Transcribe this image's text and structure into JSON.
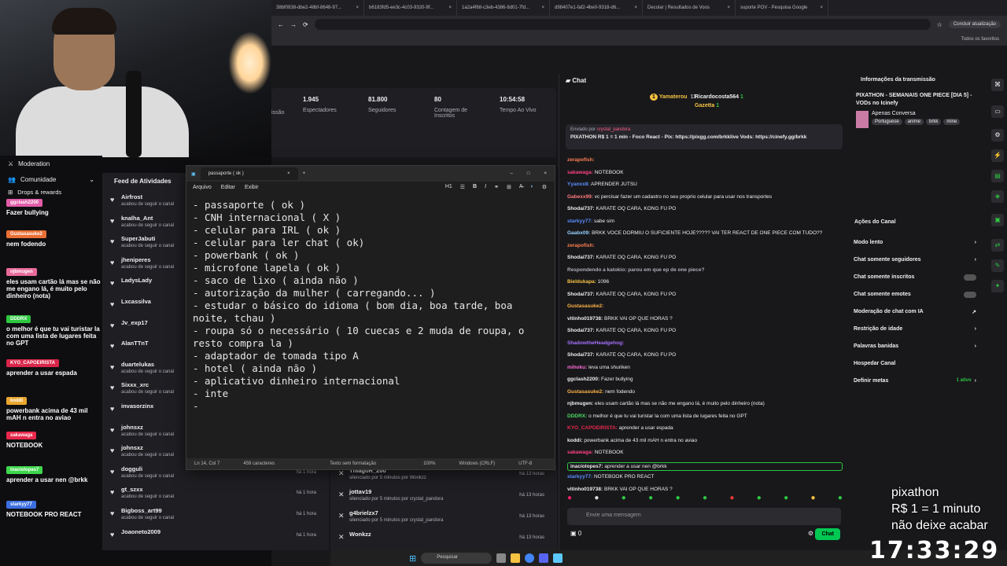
{
  "browser": {
    "tabs": [
      "38bf0938-dbe2-48bf-8648-97...",
      "b6183fd5-ee3c-4c03-9320-9f...",
      "1a2a4f68-c3eb-4386-8d01-7fd...",
      "d98407e1-faf2-4be0-9318-d6...",
      "Decolar | Resultados de Voos",
      "suporte POV - Pesquisa Google"
    ],
    "update_button": "Concluir atualização",
    "favorites": "Todos os favoritos"
  },
  "stats": [
    {
      "value": "1.945",
      "label": "Espectadores"
    },
    {
      "value": "81.800",
      "label": "Seguidores"
    },
    {
      "value": "80",
      "label": "Contagem de Inscritos"
    },
    {
      "value": "10:54:58",
      "label": "Tempo Ao Vivo"
    }
  ],
  "stats_partial": "issão",
  "left_nav": {
    "moderation": "Moderation",
    "community": "Comunidade",
    "drops": "Drops & rewards"
  },
  "alerts": [
    {
      "tag": "ggclash2200",
      "msg": "Fazer bullying",
      "color": "#e25ca8"
    },
    {
      "tag": "Gustasasuke2",
      "msg": "nem fodendo",
      "color": "#e96f35"
    },
    {
      "tag": "njbmugen",
      "msg": "eles usam cartão lá mas se não me engano lá, é muito pelo dinheiro (nota)",
      "color": "#e86a9a"
    },
    {
      "tag": "DDDRX",
      "msg": "o melhor é que tu vai turistar la com uma lista de lugares feita no GPT",
      "color": "#2ec741"
    },
    {
      "tag": "KYO_CAPOEIRISTA",
      "msg": "aprender a usar espada",
      "color": "#d9264a"
    },
    {
      "tag": "koddi",
      "msg": "powerbank acima de 43 mil mAH n entra no aviao",
      "color": "#e9a72f"
    },
    {
      "tag": "sakawaga",
      "msg": "NOTEBOOK",
      "color": "#e8284b"
    },
    {
      "tag": "inaciolopes7",
      "msg": "aprender a usar nen @brkk",
      "color": "#3fd64d"
    },
    {
      "tag": "starkyy77",
      "msg": "NOTEBOOK PRO REACT",
      "color": "#3c6fe0"
    }
  ],
  "feed": {
    "title": "Feed de Atividades",
    "items": [
      {
        "name": "Airfrost",
        "sub": "acabou de seguir o canal",
        "time": "há 1 hora"
      },
      {
        "name": "knalha_Ant",
        "sub": "acabou de seguir o canal",
        "time": "há 1 hora"
      },
      {
        "name": "SuperJabuti",
        "sub": "acabou de seguir o canal",
        "time": "há 1 hora"
      },
      {
        "name": "jheniperes",
        "sub": "acabou de seguir o canal",
        "time": "há 1 hora"
      },
      {
        "name": "LadysLady",
        "sub": "",
        "time": ""
      },
      {
        "name": "Lxcassilva",
        "sub": "",
        "time": ""
      },
      {
        "name": "Jv_exp17",
        "sub": "",
        "time": ""
      },
      {
        "name": "AlanTTnT",
        "sub": "",
        "time": ""
      },
      {
        "name": "duartelukas",
        "sub": "acabou de seguir o canal",
        "time": "há 1 hora"
      },
      {
        "name": "Sixxx_xrc",
        "sub": "acabou de seguir o canal",
        "time": "há 1 hora"
      },
      {
        "name": "invasorzinx",
        "sub": "",
        "time": ""
      },
      {
        "name": "johnsxz",
        "sub": "acabou de seguir o canal",
        "time": "há 1 hora"
      },
      {
        "name": "johnsxz",
        "sub": "acabou de seguir o canal",
        "time": "há 1 hora"
      },
      {
        "name": "dogguli",
        "sub": "acabou de seguir o canal",
        "time": "há 1 hora"
      },
      {
        "name": "gt_szxx",
        "sub": "acabou de seguir o canal",
        "time": "há 1 hora"
      },
      {
        "name": "Bigboss_art99",
        "sub": "acabou de seguir o canal",
        "time": "há 1 hora"
      },
      {
        "name": "Joaoneto2009",
        "sub": "",
        "time": "há 1 hora"
      }
    ]
  },
  "modfeed": [
    {
      "name": "ThiagoR_200",
      "sub": "silenciado por 5 minutos por Wonkzz",
      "time": "há 13 horas"
    },
    {
      "name": "jottav19",
      "sub": "silenciado por 5 minutos por crystal_pandora",
      "time": "há 13 horas"
    },
    {
      "name": "g4brielzx7",
      "sub": "silenciado por 5 minutos por crystal_pandora",
      "time": "há 13 horas"
    },
    {
      "name": "Wonkzz",
      "sub": "",
      "time": "há 13 horas"
    }
  ],
  "notepad": {
    "tab": "passaporte ( ok )",
    "menu": [
      "Arquivo",
      "Editar",
      "Exibir"
    ],
    "heading": "H1",
    "text": "- passaporte ( ok )\n- CNH internacional ( X )\n- celular para IRL ( ok )\n- celular para ler chat ( ok)\n- powerbank ( ok )\n- microfone lapela ( ok )\n- saco de lixo ( ainda não )\n- autorização da mulher ( carregando... )\n- estudar o básico do idioma ( bom dia, boa tarde, boa noite, tchau )\n- roupa só o necessário ( 10 cuecas e 2 muda de roupa, o resto compra la )\n- adaptador de tomada tipo A\n- hotel ( ainda não )\n- aplicativo dinheiro internacional\n- inte\n-",
    "status": [
      "Ln 14, Col 7",
      "459 caracteres",
      "Texto sem formatação",
      "100%",
      "Windows (CRLF)",
      "UTF-8"
    ]
  },
  "chat": {
    "title": "Chat",
    "top_users": [
      {
        "name": "Yamaterou",
        "count": "11"
      },
      {
        "name": "Ricardocosta564",
        "count": "1"
      },
      {
        "name": "Gazetta",
        "count": "1"
      }
    ],
    "pinned_by": "Enviado por",
    "pinned_user": "crystal_pandora",
    "pinned_text": "PIXATHON R$ 1 = 1 min - Foco React - Pix: https://pixgg.com/brkklive Vods: https://cinefy.gg/brkk",
    "messages": [
      {
        "user": "zerapofish:",
        "text": "",
        "color": "#ff7f50"
      },
      {
        "user": "sakawaga:",
        "text": "NOTEBOOK",
        "color": "#ff4081"
      },
      {
        "user": "Yyanxx8:",
        "text": "APRENDER JUTSU",
        "color": "#5b8dff"
      },
      {
        "user": "Gabexx99:",
        "text": "vc percisar fazer um cadastro no seu proprio celular para usar nos transportes",
        "color": "#ff7b7b"
      },
      {
        "user": "Shodai737:",
        "text": "KARATÊ OQ CARA, KONG FU PÔ",
        "color": "#efeff1"
      },
      {
        "user": "starkyy77:",
        "text": "sabe sim",
        "color": "#5b8dff"
      },
      {
        "user": "Gaabx09:",
        "text": "BRKK VOCE DORMIU O SUFICIENTE HOJE????? VAI TER REACT DE ONE PIECE COM TUDO??",
        "color": "#9ad3ff"
      },
      {
        "user": "zerapofish:",
        "text": "",
        "color": "#ff7f50"
      },
      {
        "user": "Shodai737:",
        "text": "KARATÊ OQ CARA, KONG FU PÔ",
        "color": "#efeff1"
      },
      {
        "user": "Respondendo a katokio: parou em que ep de one piece?",
        "text": "",
        "color": "#adadb8"
      },
      {
        "user": "Bieldukapa:",
        "text": "1096",
        "color": "#f5c242"
      },
      {
        "user": "Shodai737:",
        "text": "KARATÊ OQ CARA, KONG FU PÔ",
        "color": "#efeff1"
      },
      {
        "user": "Gustasasuke2:",
        "text": "",
        "color": "#ffb347"
      },
      {
        "user": "vitinho019738:",
        "text": "BRKK VAI OP QUE HORAS ?",
        "color": "#efeff1"
      },
      {
        "user": "Shodai737:",
        "text": "KARATÊ OQ CARA, KONG FU PÔ",
        "color": "#efeff1"
      },
      {
        "user": "ShadowtheHeadgehog:",
        "text": "",
        "color": "#a970ff"
      },
      {
        "user": "Shodai737:",
        "text": "KARATÊ OQ CARA, KONG FU PÔ",
        "color": "#efeff1"
      },
      {
        "user": "mihoku:",
        "text": "leva uma shuriken",
        "color": "#ff6bd5"
      },
      {
        "user": "ggclash2200:",
        "text": "Fazer bullying",
        "color": "#efeff1"
      },
      {
        "user": "Gustasasuke2:",
        "text": "nem fodendo",
        "color": "#ffb347"
      },
      {
        "user": "njbmugen:",
        "text": "eles usam cartão lá mas se não me engano lá, é muito pelo dinheiro (nota)",
        "color": "#efeff1"
      },
      {
        "user": "DDDRX:",
        "text": "o melhor é que tu vai turistar la com uma lista de lugares feita no GPT",
        "color": "#4cd964"
      },
      {
        "user": "KYO_CAPOEIRISTA:",
        "text": "aprender a usar espada",
        "color": "#e8284b"
      },
      {
        "user": "koddi:",
        "text": "powerbank acima de 43 mil mAH n entra no aviao",
        "color": "#efeff1"
      },
      {
        "user": "sakawaga:",
        "text": "NOTEBOOK",
        "color": "#ff4081"
      },
      {
        "user": "inaciolopes7:",
        "text": "aprender a usar nen @brkk",
        "color": "#efeff1"
      },
      {
        "user": "starkyy77:",
        "text": "NOTEBOOK PRO REACT",
        "color": "#5b8dff"
      },
      {
        "user": "vitinho019738:",
        "text": "BRKK VAI OP QUE HORAS ?",
        "color": "#efeff1"
      }
    ],
    "placeholder": "Envie uma mensagem",
    "points": "0",
    "send": "Chat"
  },
  "info": {
    "title": "Informações da transmissão",
    "stream_title": "PIXATHON - SEMANAIS ONE PIECE [DIA 5] - VODs no Icinefy",
    "category": "Apenas Conversa",
    "tags": [
      "Portuguese",
      "anime",
      "brkk",
      "mine"
    ]
  },
  "actions": {
    "title": "Ações do Canal",
    "items": [
      {
        "label": "Modo lento",
        "type": "arrow"
      },
      {
        "label": "Chat somente seguidores",
        "type": "arrow"
      },
      {
        "label": "Chat somente inscritos",
        "type": "toggle"
      },
      {
        "label": "Chat somente emotes",
        "type": "toggle"
      },
      {
        "label": "Moderação de chat com IA",
        "type": "ext"
      },
      {
        "label": "Restrição de idade",
        "type": "arrow"
      },
      {
        "label": "Palavras banidas",
        "type": "arrow"
      },
      {
        "label": "Hospedar Canal",
        "type": "none"
      },
      {
        "label": "Definir metas",
        "type": "arrow",
        "extra": "1 ativo"
      }
    ]
  },
  "overlay": {
    "line1": "pixathon",
    "line2": "R$ 1 = 1 minuto",
    "line3": "não deixe acabar",
    "clock": "17:33:29"
  },
  "taskbar": {
    "search": "Pesquisar"
  }
}
